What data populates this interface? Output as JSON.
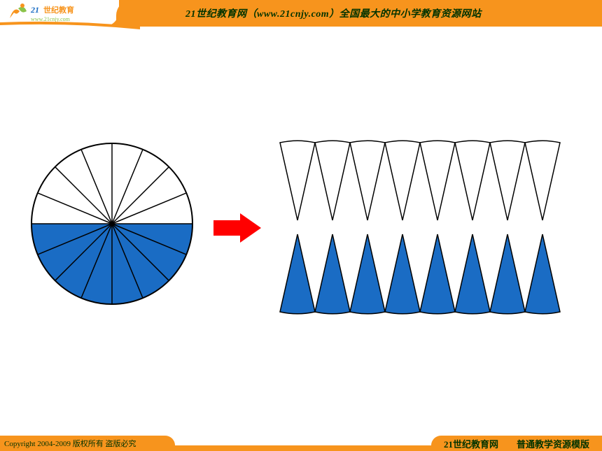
{
  "header": {
    "logo_text_primary": "21世纪教育",
    "logo_text_secondary": "www.21cnjy.com",
    "tagline": "21世纪教育网（www.21cnjy.com）全国最大的中小学教育资源网站"
  },
  "diagram": {
    "description": "circle-area-rearrangement",
    "colors": {
      "filled": "#1a6cc4",
      "outline": "#000000",
      "arrow": "#ff0000"
    },
    "circle": {
      "sectors": 16,
      "filled_half": "bottom"
    },
    "rearranged": {
      "top_sectors": 8,
      "bottom_sectors": 8,
      "top_filled": false,
      "bottom_filled": true
    }
  },
  "footer": {
    "copyright": "Copyright 2004-2009 版权所有 盗版必究",
    "brand": "21世纪教育网",
    "template": "普通教学资源模版"
  }
}
